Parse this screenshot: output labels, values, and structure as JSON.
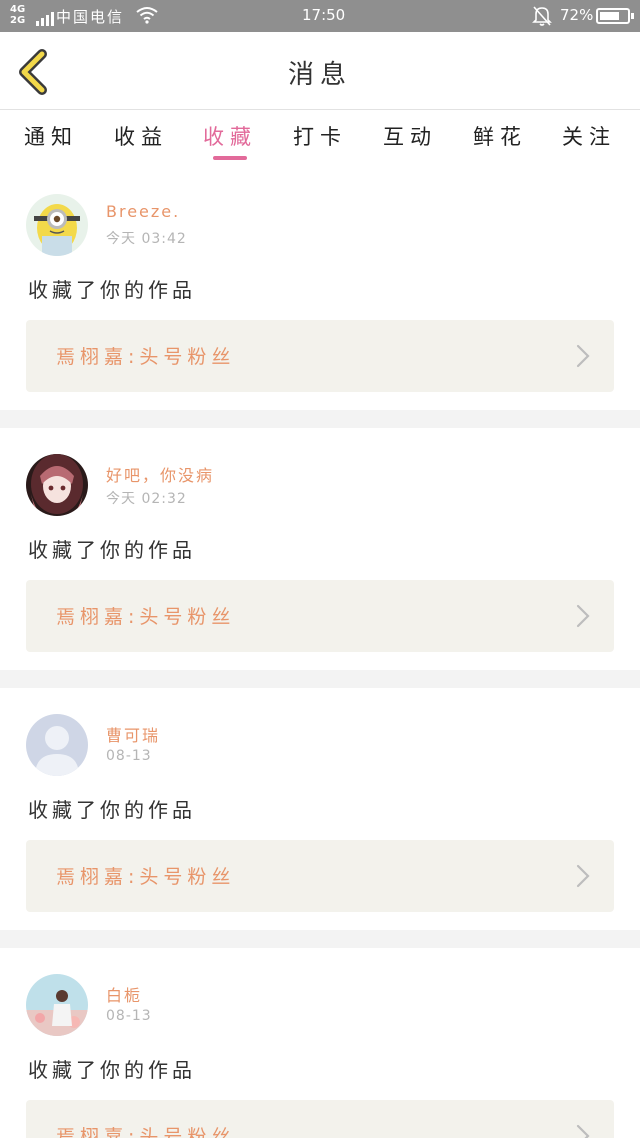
{
  "status_bar": {
    "network_top": "4G",
    "network_bottom": "2G",
    "carrier": "中国电信",
    "time": "17:50",
    "battery_percent": "72%",
    "battery_level": 0.72,
    "icons": [
      "signal-icon",
      "wifi-icon",
      "bell-off-icon",
      "battery-icon"
    ]
  },
  "header": {
    "title": "消息",
    "back_icon": "chevron-left-icon"
  },
  "tabs": [
    {
      "label": "通知",
      "active": false
    },
    {
      "label": "收益",
      "active": false
    },
    {
      "label": "收藏",
      "active": true
    },
    {
      "label": "打卡",
      "active": false
    },
    {
      "label": "互动",
      "active": false
    },
    {
      "label": "鲜花",
      "active": false
    },
    {
      "label": "关注",
      "active": false
    }
  ],
  "colors": {
    "accent": "#e26a9a",
    "username": "#e8956a",
    "work_box_bg": "#f3f2ec"
  },
  "messages": [
    {
      "username": "Breeze.",
      "time": "今天 03:42",
      "text": "收藏了你的作品",
      "work": "焉栩嘉:头号粉丝",
      "avatar": "minion-avatar"
    },
    {
      "username": "好吧，你没病",
      "time": "今天 02:32",
      "text": "收藏了你的作品",
      "work": "焉栩嘉:头号粉丝",
      "avatar": "anime-girl-avatar"
    },
    {
      "username": "曹可瑞",
      "time": "08-13",
      "text": "收藏了你的作品",
      "work": "焉栩嘉:头号粉丝",
      "avatar": "default-user-avatar"
    },
    {
      "username": "白栀",
      "time": "08-13",
      "text": "收藏了你的作品",
      "work": "焉栩嘉:头号粉丝",
      "avatar": "beach-girl-avatar"
    }
  ]
}
